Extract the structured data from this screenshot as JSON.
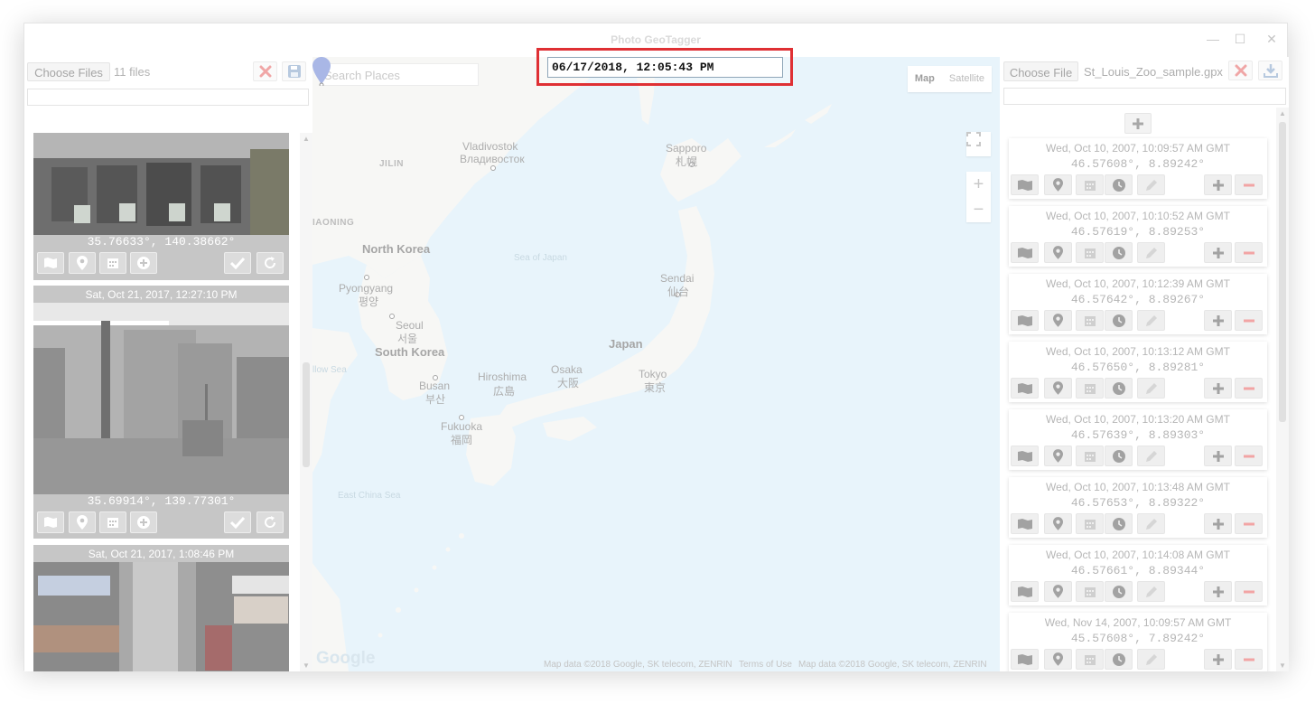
{
  "window": {
    "title": "Photo GeoTagger",
    "minimize_glyph": "—",
    "maximize_glyph": "☐",
    "close_glyph": "✕"
  },
  "left_panel": {
    "choose_files_label": "Choose Files",
    "file_count": "11 files",
    "clear_icon": "x-icon",
    "save_icon": "save-icon",
    "filter_value": "",
    "photos": [
      {
        "date": "",
        "coords": "35.76633°, 140.38662°"
      },
      {
        "date": "Sat, Oct 21, 2017, 12:27:10 PM",
        "coords": "35.69914°, 139.77301°"
      },
      {
        "date": "Sat, Oct 21, 2017, 1:08:46 PM",
        "coords": ""
      }
    ],
    "tool_icons": [
      "map-icon",
      "pin-icon",
      "calendar-icon",
      "plus-circle-icon",
      "check-icon",
      "refresh-icon"
    ]
  },
  "date_popup": {
    "value": "06/17/2018, 12:05:43 PM",
    "border_color": "#df3034"
  },
  "map": {
    "search_placeholder": "Search Places",
    "type_map": "Map",
    "type_satellite": "Satellite",
    "zoom_in": "+",
    "zoom_out": "−",
    "logo": "Google",
    "attribution_1": "Map data ©2018 Google, SK telecom, ZENRIN",
    "terms": "Terms of Use",
    "attribution_2": "Map data ©2018 Google, SK telecom, ZENRIN",
    "labels": {
      "vladivostok": "Vladivostok",
      "vladivostok_ru": "Владивосток",
      "jilin": "JILIN",
      "liaoning": "IAONING",
      "north_korea": "North Korea",
      "sea_of_japan": "Sea of Japan",
      "pyongyang": "Pyongyang",
      "pyongyang_ko": "평양",
      "seoul": "Seoul",
      "seoul_ko": "서울",
      "south_korea": "South Korea",
      "yellow_sea": "llow Sea",
      "busan": "Busan",
      "busan_ko": "부산",
      "hiroshima": "Hiroshima",
      "hiroshima_ja": "広島",
      "osaka": "Osaka",
      "osaka_ja": "大阪",
      "japan": "Japan",
      "tokyo": "Tokyo",
      "tokyo_ja": "東京",
      "sendai": "Sendai",
      "sendai_ja": "仙台",
      "sapporo": "Sapporo",
      "sapporo_ja": "札幌",
      "fukuoka": "Fukuoka",
      "fukuoka_ja": "福岡",
      "east_china_sea": "East China Sea"
    }
  },
  "right_panel": {
    "choose_file_label": "Choose File",
    "file_name": "St_Louis_Zoo_sample.gpx",
    "clear_icon": "x-icon",
    "download_icon": "download-icon",
    "filter_value": "",
    "add_icon": "plus-icon",
    "waypoints": [
      {
        "date": "Wed, Oct 10, 2007, 10:09:57 AM GMT",
        "coords": "46.57608°, 8.89242°"
      },
      {
        "date": "Wed, Oct 10, 2007, 10:10:52 AM GMT",
        "coords": "46.57619°, 8.89253°"
      },
      {
        "date": "Wed, Oct 10, 2007, 10:12:39 AM GMT",
        "coords": "46.57642°, 8.89267°"
      },
      {
        "date": "Wed, Oct 10, 2007, 10:13:12 AM GMT",
        "coords": "46.57650°, 8.89281°"
      },
      {
        "date": "Wed, Oct 10, 2007, 10:13:20 AM GMT",
        "coords": "46.57639°, 8.89303°"
      },
      {
        "date": "Wed, Oct 10, 2007, 10:13:48 AM GMT",
        "coords": "46.57653°, 8.89322°"
      },
      {
        "date": "Wed, Oct 10, 2007, 10:14:08 AM GMT",
        "coords": "46.57661°, 8.89344°"
      },
      {
        "date": "Wed, Nov 14, 2007, 10:09:57 AM GMT",
        "coords": "45.57608°, 7.89242°"
      }
    ],
    "waypoint_icons": [
      "map-icon",
      "pin-icon",
      "calendar-icon",
      "clock-icon",
      "pencil-icon",
      "plus-icon",
      "minus-icon"
    ]
  }
}
